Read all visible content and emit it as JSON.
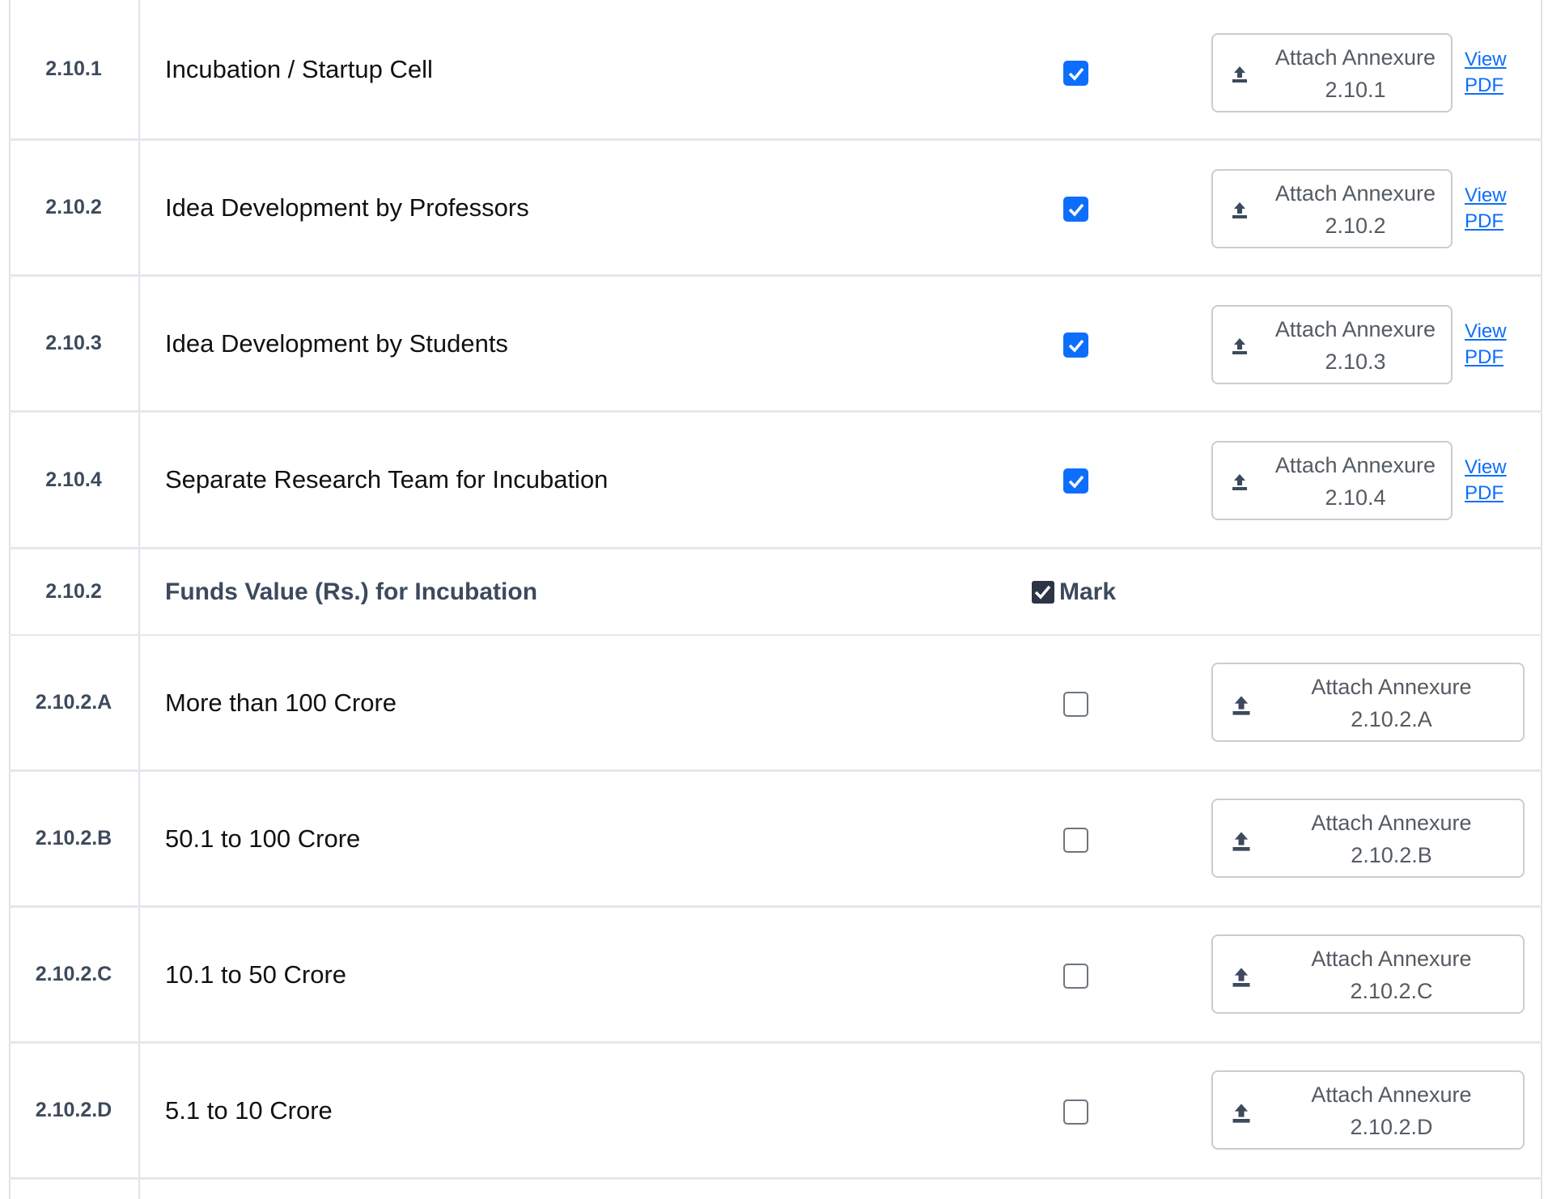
{
  "rows": [
    {
      "num": "2.10.1",
      "label": "Incubation / Startup Cell",
      "checked": true,
      "attach_label": "Attach Annexure",
      "attach_code": "2.10.1",
      "view": "View",
      "pdf": "PDF"
    },
    {
      "num": "2.10.2",
      "label": "Idea Development by Professors",
      "checked": true,
      "attach_label": "Attach Annexure",
      "attach_code": "2.10.2",
      "view": "View",
      "pdf": "PDF"
    },
    {
      "num": "2.10.3",
      "label": "Idea Development by Students",
      "checked": true,
      "attach_label": "Attach Annexure",
      "attach_code": "2.10.3",
      "view": "View",
      "pdf": "PDF"
    },
    {
      "num": "2.10.4",
      "label": "Separate Research Team for Incubation",
      "checked": true,
      "attach_label": "Attach Annexure",
      "attach_code": "2.10.4",
      "view": "View",
      "pdf": "PDF"
    }
  ],
  "section": {
    "num": "2.10.2",
    "label": "Funds Value (Rs.) for Incubation",
    "mark_label": "Mark",
    "mark_checked": true
  },
  "fund_rows": [
    {
      "num": "2.10.2.A",
      "label": "More than 100 Crore",
      "checked": false,
      "attach_label": "Attach Annexure",
      "attach_code": "2.10.2.A"
    },
    {
      "num": "2.10.2.B",
      "label": "50.1 to 100 Crore",
      "checked": false,
      "attach_label": "Attach Annexure",
      "attach_code": "2.10.2.B"
    },
    {
      "num": "2.10.2.C",
      "label": "10.1 to 50 Crore",
      "checked": false,
      "attach_label": "Attach Annexure",
      "attach_code": "2.10.2.C"
    },
    {
      "num": "2.10.2.D",
      "label": "5.1 to 10 Crore",
      "checked": false,
      "attach_label": "Attach Annexure",
      "attach_code": "2.10.2.D"
    }
  ],
  "colors": {
    "accent": "#0d6efd",
    "heading": "#3d4a5c",
    "border": "#dee2e6"
  },
  "icons": {
    "upload": "upload-icon",
    "check": "checkmark-icon"
  }
}
